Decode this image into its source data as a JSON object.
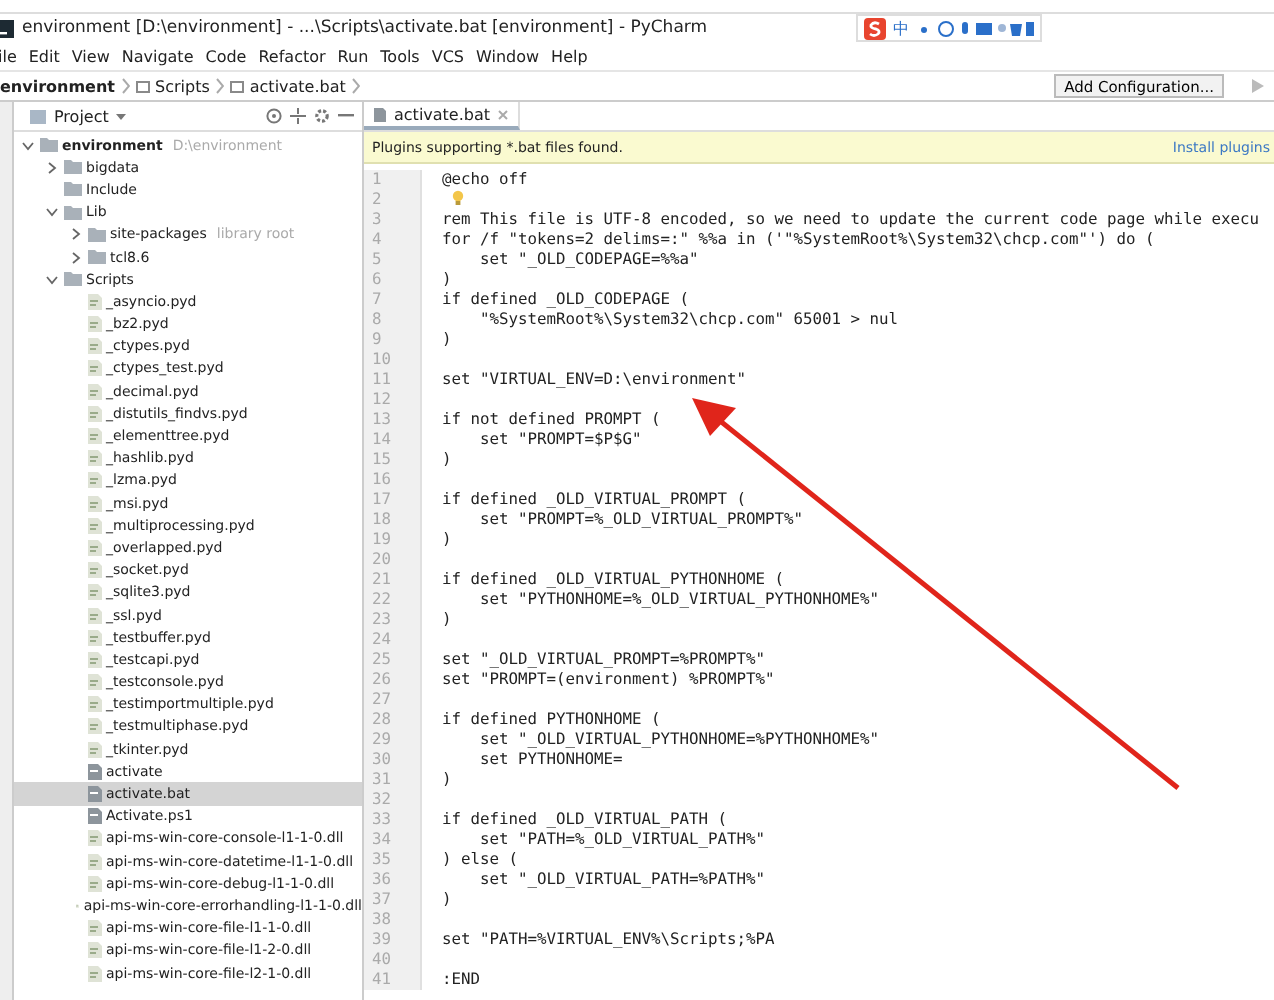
{
  "window": {
    "title": "environment [D:\\environment] - ...\\Scripts\\activate.bat [environment] - PyCharm"
  },
  "ime_toolbar": {
    "mode": "中"
  },
  "menu": [
    "ile",
    "Edit",
    "View",
    "Navigate",
    "Code",
    "Refactor",
    "Run",
    "Tools",
    "VCS",
    "Window",
    "Help"
  ],
  "breadcrumbs": [
    "environment",
    "Scripts",
    "activate.bat"
  ],
  "run_config": {
    "label": "Add Configuration..."
  },
  "project_panel": {
    "title": "Project",
    "tree": [
      {
        "name": "environment",
        "hint": "D:\\environment",
        "kind": "folder",
        "expanded": true,
        "selected": false,
        "children": [
          {
            "name": "bigdata",
            "kind": "folder",
            "expanded": false,
            "selected": false
          },
          {
            "name": "Include",
            "kind": "folder",
            "selected": false
          },
          {
            "name": "Lib",
            "kind": "folder",
            "expanded": true,
            "selected": false,
            "children": [
              {
                "name": "site-packages",
                "hint": "library root",
                "kind": "folder",
                "expanded": false,
                "selected": false
              },
              {
                "name": "tcl8.6",
                "kind": "folder",
                "expanded": false,
                "selected": false
              }
            ]
          },
          {
            "name": "Scripts",
            "kind": "folder",
            "expanded": true,
            "selected": false,
            "children": [
              {
                "name": "_asyncio.pyd",
                "kind": "binary",
                "selected": false
              },
              {
                "name": "_bz2.pyd",
                "kind": "binary",
                "selected": false
              },
              {
                "name": "_ctypes.pyd",
                "kind": "binary",
                "selected": false
              },
              {
                "name": "_ctypes_test.pyd",
                "kind": "binary",
                "selected": false
              },
              {
                "name": "_decimal.pyd",
                "kind": "binary",
                "selected": false
              },
              {
                "name": "_distutils_findvs.pyd",
                "kind": "binary",
                "selected": false
              },
              {
                "name": "_elementtree.pyd",
                "kind": "binary",
                "selected": false
              },
              {
                "name": "_hashlib.pyd",
                "kind": "binary",
                "selected": false
              },
              {
                "name": "_lzma.pyd",
                "kind": "binary",
                "selected": false
              },
              {
                "name": "_msi.pyd",
                "kind": "binary",
                "selected": false
              },
              {
                "name": "_multiprocessing.pyd",
                "kind": "binary",
                "selected": false
              },
              {
                "name": "_overlapped.pyd",
                "kind": "binary",
                "selected": false
              },
              {
                "name": "_socket.pyd",
                "kind": "binary",
                "selected": false
              },
              {
                "name": "_sqlite3.pyd",
                "kind": "binary",
                "selected": false
              },
              {
                "name": "_ssl.pyd",
                "kind": "binary",
                "selected": false
              },
              {
                "name": "_testbuffer.pyd",
                "kind": "binary",
                "selected": false
              },
              {
                "name": "_testcapi.pyd",
                "kind": "binary",
                "selected": false
              },
              {
                "name": "_testconsole.pyd",
                "kind": "binary",
                "selected": false
              },
              {
                "name": "_testimportmultiple.pyd",
                "kind": "binary",
                "selected": false
              },
              {
                "name": "_testmultiphase.pyd",
                "kind": "binary",
                "selected": false
              },
              {
                "name": "_tkinter.pyd",
                "kind": "binary",
                "selected": false
              },
              {
                "name": "activate",
                "kind": "script",
                "selected": false
              },
              {
                "name": "activate.bat",
                "kind": "script",
                "selected": true
              },
              {
                "name": "Activate.ps1",
                "kind": "script",
                "selected": false
              },
              {
                "name": "api-ms-win-core-console-l1-1-0.dll",
                "kind": "binary",
                "selected": false
              },
              {
                "name": "api-ms-win-core-datetime-l1-1-0.dll",
                "kind": "binary",
                "selected": false
              },
              {
                "name": "api-ms-win-core-debug-l1-1-0.dll",
                "kind": "binary",
                "selected": false
              },
              {
                "name": "api-ms-win-core-errorhandling-l1-1-0.dll",
                "kind": "binary",
                "selected": false
              },
              {
                "name": "api-ms-win-core-file-l1-1-0.dll",
                "kind": "binary",
                "selected": false
              },
              {
                "name": "api-ms-win-core-file-l1-2-0.dll",
                "kind": "binary",
                "selected": false
              },
              {
                "name": "api-ms-win-core-file-l2-1-0.dll",
                "kind": "binary",
                "selected": false
              }
            ]
          }
        ]
      }
    ]
  },
  "editor": {
    "tabs": [
      {
        "label": "activate.bat",
        "selected": true
      }
    ],
    "banner": {
      "text": "Plugins supporting *.bat files found.",
      "action": "Install plugins"
    },
    "lines": [
      {
        "number": "1",
        "code": "@echo off"
      },
      {
        "number": "2"
      },
      {
        "number": "3",
        "code": "rem This file is UTF-8 encoded, so we need to update the current code page while execu"
      },
      {
        "number": "4",
        "code": "for /f \"tokens=2 delims=:\" %%a in ('\"%SystemRoot%\\System32\\chcp.com\"') do ("
      },
      {
        "number": "5",
        "code": "    set \"_OLD_CODEPAGE=%%a\""
      },
      {
        "number": "6",
        "code": ")"
      },
      {
        "number": "7",
        "code": "if defined _OLD_CODEPAGE ("
      },
      {
        "number": "8",
        "code": "    \"%SystemRoot%\\System32\\chcp.com\" 65001 > nul"
      },
      {
        "number": "9",
        "code": ")"
      },
      {
        "number": "10"
      },
      {
        "number": "11",
        "code": "set \"VIRTUAL_ENV=D:\\environment\""
      },
      {
        "number": "12"
      },
      {
        "number": "13",
        "code": "if not defined PROMPT ("
      },
      {
        "number": "14",
        "code": "    set \"PROMPT=$P$G\""
      },
      {
        "number": "15",
        "code": ")"
      },
      {
        "number": "16"
      },
      {
        "number": "17",
        "code": "if defined _OLD_VIRTUAL_PROMPT ("
      },
      {
        "number": "18",
        "code": "    set \"PROMPT=%_OLD_VIRTUAL_PROMPT%\""
      },
      {
        "number": "19",
        "code": ")"
      },
      {
        "number": "20"
      },
      {
        "number": "21",
        "code": "if defined _OLD_VIRTUAL_PYTHONHOME ("
      },
      {
        "number": "22",
        "code": "    set \"PYTHONHOME=%_OLD_VIRTUAL_PYTHONHOME%\""
      },
      {
        "number": "23",
        "code": ")"
      },
      {
        "number": "24"
      },
      {
        "number": "25",
        "code": "set \"_OLD_VIRTUAL_PROMPT=%PROMPT%\""
      },
      {
        "number": "26",
        "code": "set \"PROMPT=(environment) %PROMPT%\""
      },
      {
        "number": "27"
      },
      {
        "number": "28",
        "code": "if defined PYTHONHOME ("
      },
      {
        "number": "29",
        "code": "    set \"_OLD_VIRTUAL_PYTHONHOME=%PYTHONHOME%\""
      },
      {
        "number": "30",
        "code": "    set PYTHONHOME="
      },
      {
        "number": "31",
        "code": ")"
      },
      {
        "number": "32"
      },
      {
        "number": "33",
        "code": "if defined _OLD_VIRTUAL_PATH ("
      },
      {
        "number": "34",
        "code": "    set \"PATH=%_OLD_VIRTUAL_PATH%\""
      },
      {
        "number": "35",
        "code": ") else ("
      },
      {
        "number": "36",
        "code": "    set \"_OLD_VIRTUAL_PATH=%PATH%\""
      },
      {
        "number": "37",
        "code": ")"
      },
      {
        "number": "38"
      },
      {
        "number": "39",
        "code": "set \"PATH=%VIRTUAL_ENV%\\Scripts;%PA"
      },
      {
        "number": "40"
      },
      {
        "number": "41",
        "code": ":END"
      }
    ]
  }
}
